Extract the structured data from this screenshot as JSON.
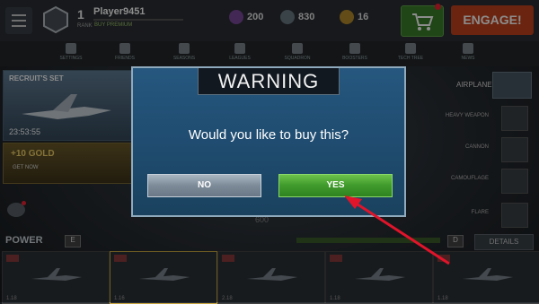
{
  "header": {
    "rank": "1",
    "rank_sub": "RANK",
    "player_name": "Player9451",
    "buy_premium": "BUY PREMIUM",
    "currency_purple": "200",
    "currency_silver": "830",
    "currency_gold": "16",
    "engage_label": "ENGAGE!"
  },
  "tabs": [
    {
      "label": "SETTINGS"
    },
    {
      "label": "FRIENDS"
    },
    {
      "label": "SEASONS"
    },
    {
      "label": "LEAGUES"
    },
    {
      "label": "SQUADRON"
    },
    {
      "label": "BOOSTERS"
    },
    {
      "label": "TECH TREE"
    },
    {
      "label": "NEWS"
    }
  ],
  "left_panel": {
    "offer_title": "RECRUIT'S SET",
    "offer_timer": "23:53:55",
    "gold_title": "+10 GOLD",
    "gold_sub": "GET NOW"
  },
  "right_panel": {
    "airplane": "AIRPLANE",
    "heavy_weapon": "HEAVY WEAPON",
    "cannon": "CANNON",
    "camouflage": "CAMOUFLAGE",
    "flare": "FLARE"
  },
  "power": {
    "label": "POWER",
    "grade_left": "E",
    "grade_right": "D",
    "details_label": "DETAILS"
  },
  "center_price": "600",
  "hangar": [
    {
      "num": "1.18"
    },
    {
      "num": "1.16"
    },
    {
      "num": "2.18"
    },
    {
      "num": "1.18"
    },
    {
      "num": "1.18"
    }
  ],
  "dialog": {
    "title": "WARNING",
    "message": "Would you like to buy this?",
    "no_label": "NO",
    "yes_label": "YES"
  },
  "colors": {
    "yes_button": "#3f9a2c",
    "no_button": "#7d8b99",
    "dialog_bg": "#1f4c70",
    "annotation_arrow": "#e0142a"
  }
}
